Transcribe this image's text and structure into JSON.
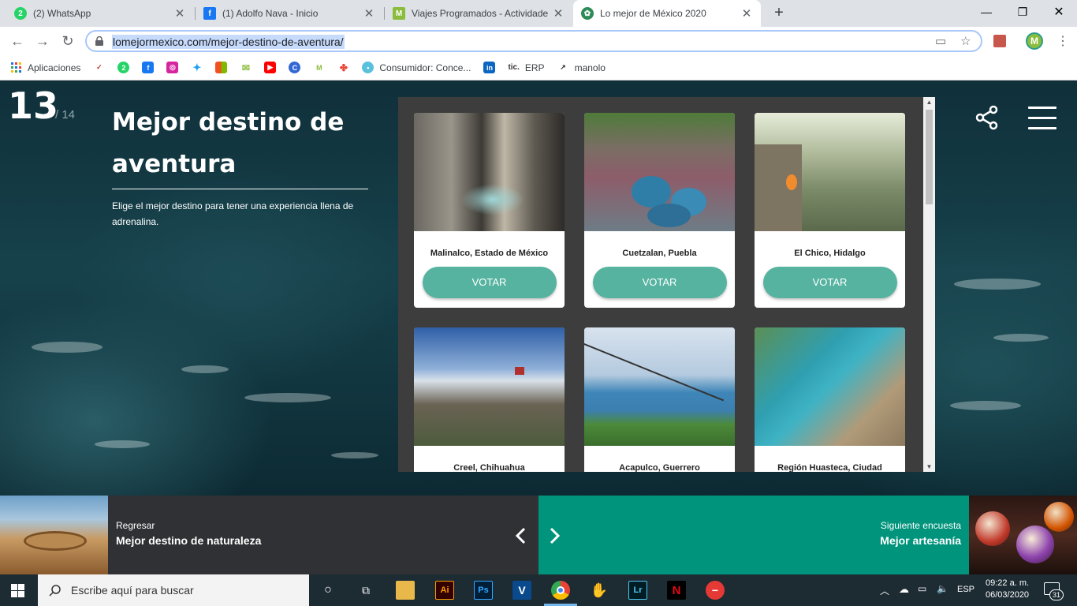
{
  "browser": {
    "tabs": [
      {
        "title": "(2) WhatsApp",
        "icon": "whatsapp-icon",
        "color": "#25d366"
      },
      {
        "title": "(1) Adolfo Nava - Inicio",
        "icon": "facebook-icon",
        "color": "#1877f2"
      },
      {
        "title": "Viajes Programados - Actividade",
        "icon": "viajes-icon",
        "color": "#8bbd3c"
      },
      {
        "title": "Lo mejor de México 2020",
        "icon": "lomejor-icon",
        "color": "#2e8b57"
      }
    ],
    "url": "lomejormexico.com/mejor-destino-de-aventura/",
    "bookmarks": {
      "apps": "Aplicaciones",
      "consumidor": "Consumidor: Conce...",
      "erp": "ERP",
      "manolo": "manolo",
      "tic": "tic."
    },
    "profile_initial": "M"
  },
  "page": {
    "counter_current": "13",
    "counter_total": "/ 14",
    "title_line1": "Mejor destino de",
    "title_line2": "aventura",
    "description": "Elige el mejor destino para tener una experiencia llena de adrenalina.",
    "vote_label": "VOTAR",
    "cards": [
      {
        "name": "Malinalco, Estado de México"
      },
      {
        "name": "Cuetzalan, Puebla"
      },
      {
        "name": "El Chico, Hidalgo"
      },
      {
        "name": "Creel, Chihuahua"
      },
      {
        "name": "Acapulco, Guerrero"
      },
      {
        "name": "Región Huasteca, Ciudad"
      }
    ]
  },
  "footer_nav": {
    "prev_label": "Regresar",
    "prev_title": "Mejor destino de naturaleza",
    "next_label": "Siguiente encuesta",
    "next_title": "Mejor artesanía"
  },
  "taskbar": {
    "search_placeholder": "Escribe aquí para buscar",
    "lang": "ESP",
    "time": "09:22 a. m.",
    "date": "06/03/2020",
    "notifications": "31"
  },
  "colors": {
    "accent": "#56b3a0",
    "next_bg": "#00947d",
    "prev_bg": "#2f3134"
  }
}
